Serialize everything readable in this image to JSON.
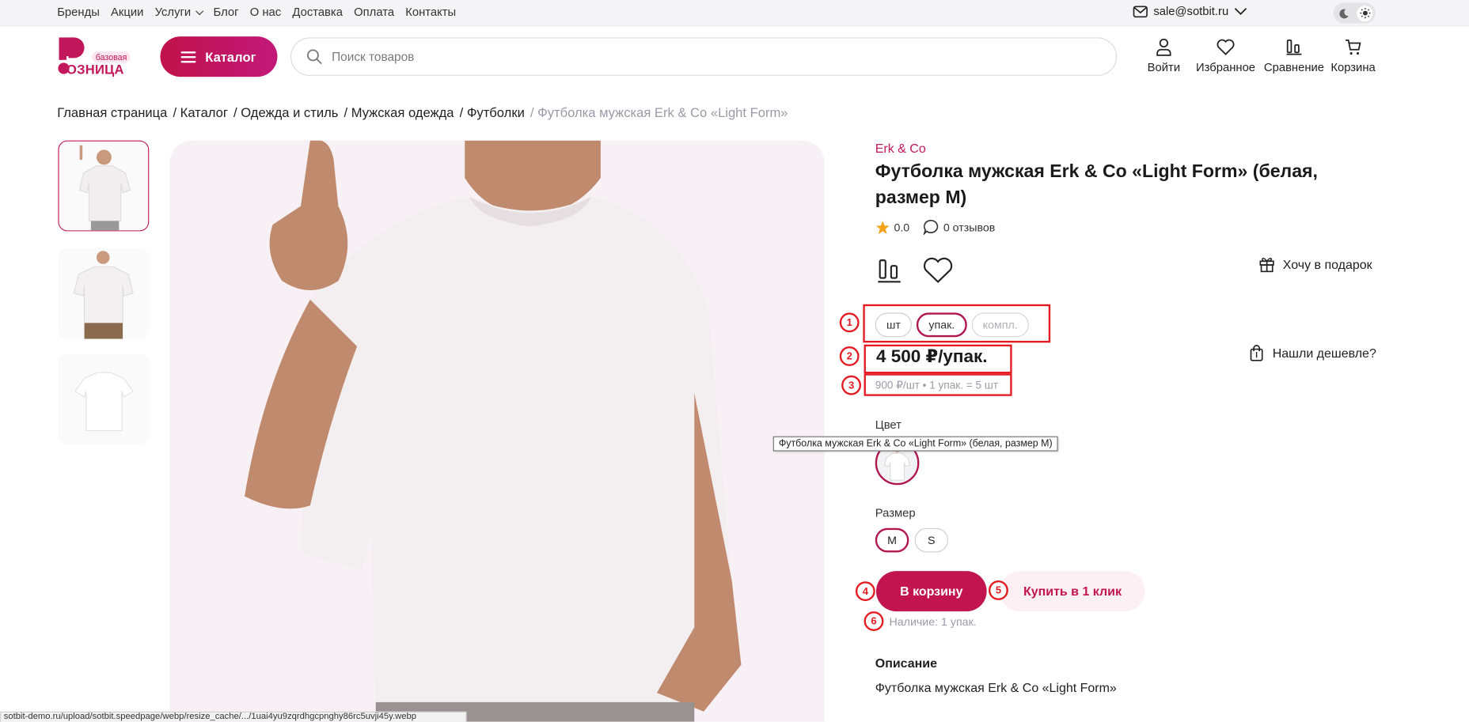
{
  "topbar": {
    "nav": [
      "Бренды",
      "Акции",
      "Услуги",
      "Блог",
      "О нас",
      "Доставка",
      "Оплата",
      "Контакты"
    ],
    "email": "sale@sotbit.ru"
  },
  "header": {
    "logo_text": "ОЗНИЦА",
    "logo_badge": "базовая",
    "catalog_label": "Каталог",
    "search_placeholder": "Поиск товаров",
    "icons": {
      "login": "Войти",
      "favorites": "Избранное",
      "compare": "Сравнение",
      "cart": "Корзина"
    }
  },
  "breadcrumb": [
    "Главная страница",
    "/ Каталог",
    "/ Одежда и стиль",
    "/ Мужская одежда",
    "/ Футболки",
    "/ Футболка мужская Erk & Co «Light Form»"
  ],
  "product": {
    "brand": "Erk & Co",
    "title": "Футболка мужская Erk & Co «Light Form» (белая, размер M)",
    "rating": "0.0",
    "reviews": "0 отзывов",
    "gift_label": "Хочу в подарок",
    "cheaper_label": "Нашли дешевле?",
    "units": [
      "шт",
      "упак.",
      "компл."
    ],
    "selected_unit": "упак.",
    "price": "4 500 ₽/упак.",
    "subprice": "900 ₽/шт • 1 упак. = 5 шт",
    "color_label": "Цвет",
    "color_tooltip": "Футболка мужская Erk & Co «Light Form» (белая, размер M)",
    "size_label": "Размер",
    "sizes": [
      "M",
      "S"
    ],
    "selected_size": "M",
    "cart_button": "В корзину",
    "oneclick_button": "Купить в 1 клик",
    "stock": "Наличие: 1 упак.",
    "description_heading": "Описание",
    "description_text": "Футболка мужская Erk & Co «Light Form»"
  },
  "annotations": [
    "1",
    "2",
    "3",
    "4",
    "5",
    "6"
  ],
  "statusbar": "sotbit-demo.ru/upload/sotbit.speedpage/webp/resize_cache/.../1uai4yu9zqrdhgcpnghy86rc5uvji45y.webp",
  "colors": {
    "accent": "#c2154f",
    "annotation": "#e41b23"
  }
}
